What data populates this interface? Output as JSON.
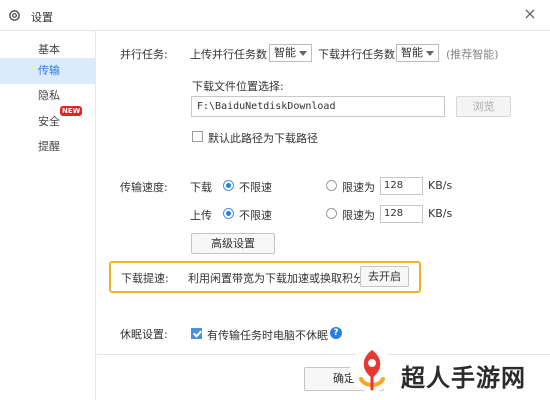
{
  "window": {
    "title": "设置"
  },
  "sidebar": {
    "items": [
      {
        "label": "基本"
      },
      {
        "label": "传输",
        "active": true
      },
      {
        "label": "隐私"
      },
      {
        "label": "安全",
        "badge": "NEW"
      },
      {
        "label": "提醒"
      }
    ]
  },
  "parallel": {
    "section_label": "并行任务:",
    "upload_label": "上传并行任务数",
    "upload_value": "智能",
    "download_label": "下载并行任务数",
    "download_value": "智能",
    "hint": "(推荐智能)"
  },
  "download_location": {
    "label": "下载文件位置选择:",
    "path": "F:\\BaiduNetdiskDownload",
    "browse_label": "浏览",
    "default_checkbox_label": "默认此路径为下载路径",
    "default_checked": false
  },
  "speed": {
    "section_label": "传输速度:",
    "download": {
      "label": "下载",
      "unlimited_label": "不限速",
      "limit_label": "限速为",
      "limit_value": "128",
      "unit": "KB/s",
      "selected": "unlimited"
    },
    "upload": {
      "label": "上传",
      "unlimited_label": "不限速",
      "limit_label": "限速为",
      "limit_value": "128",
      "unit": "KB/s",
      "selected": "unlimited"
    },
    "advanced_label": "高级设置"
  },
  "boost": {
    "section_label": "下载提速:",
    "description": "利用闲置带宽为下载加速或换取积分",
    "button_label": "去开启",
    "highlight_color": "#f0b429"
  },
  "sleep": {
    "section_label": "休眠设置:",
    "checkbox_label": "有传输任务时电脑不休眠",
    "checked": true,
    "help_glyph": "?"
  },
  "footer": {
    "confirm_label": "确定"
  },
  "watermark": {
    "text": "超人手游网"
  },
  "colors": {
    "accent": "#2a7ee0",
    "sidebar_active_bg": "#dcebfb"
  }
}
